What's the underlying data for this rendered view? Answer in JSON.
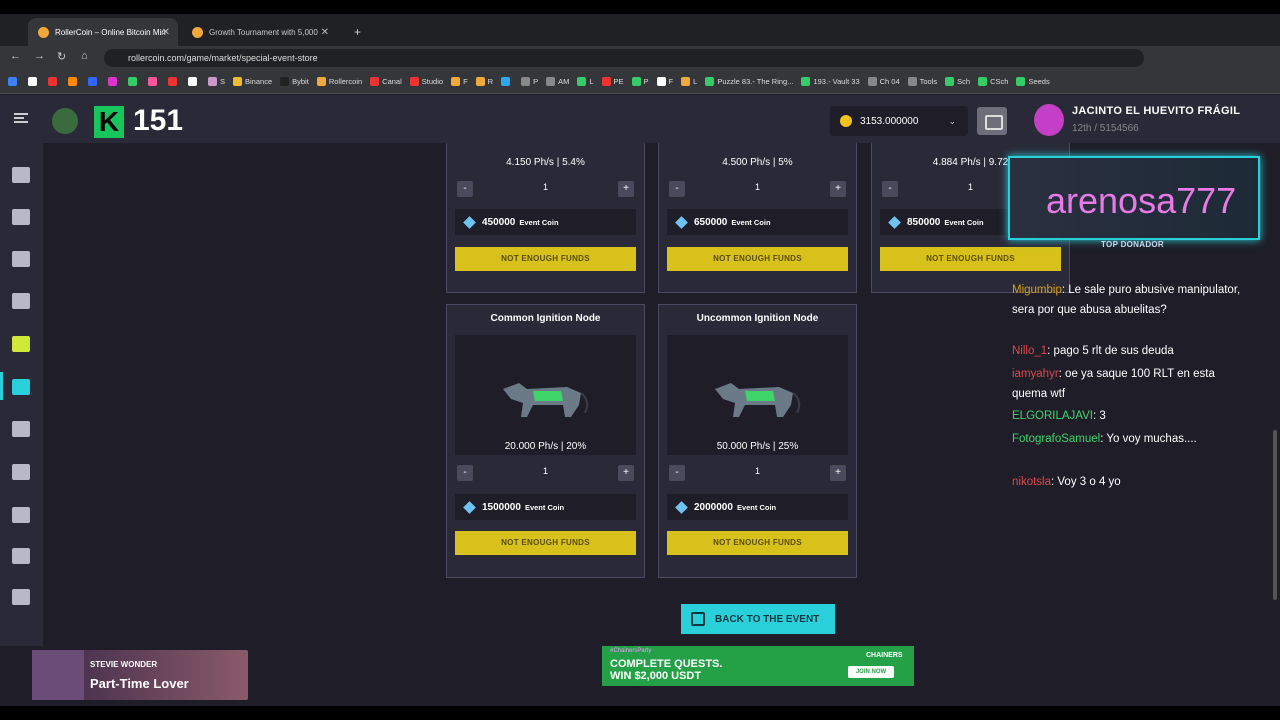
{
  "browser": {
    "tabs": [
      {
        "title": "RollerCoin – Online Bitcoin Min",
        "active": true
      },
      {
        "title": "Growth Tournament with 5,000",
        "active": false
      }
    ],
    "url": "rollercoin.com/game/market/special-event-store",
    "bookmarks": [
      "S",
      "Binance",
      "Bybit",
      "Rollercoin",
      "Canal",
      "Studio",
      "F",
      "R",
      "P",
      "AM",
      "L",
      "PE",
      "P",
      "F",
      "L",
      "Puzzle 83.- The Ring...",
      "193.- Vault 33",
      "Ch 04",
      "Tools",
      "Sch",
      "CSch",
      "Seeds"
    ]
  },
  "header": {
    "viewer_count": "151",
    "balance": "3153.000000",
    "username": "JACINTO EL HUEVITO FRÁGIL",
    "rank": "12th / 5154566"
  },
  "store": {
    "top_cards": [
      {
        "power": "4.150 Ph/s | 5.4%",
        "qty": "1",
        "price": "450000",
        "currency": "Event Coin",
        "button": "NOT ENOUGH FUNDS"
      },
      {
        "power": "4.500 Ph/s | 5%",
        "qty": "1",
        "price": "650000",
        "currency": "Event Coin",
        "button": "NOT ENOUGH FUNDS"
      },
      {
        "power": "4.884 Ph/s | 9.72",
        "qty": "1",
        "price": "850000",
        "currency": "Event Coin",
        "button": "NOT ENOUGH FUNDS"
      }
    ],
    "bottom_cards": [
      {
        "title": "Common Ignition Node",
        "power": "20.000 Ph/s | 20%",
        "qty": "1",
        "price": "1500000",
        "currency": "Event Coin",
        "button": "NOT ENOUGH FUNDS"
      },
      {
        "title": "Uncommon Ignition Node",
        "power": "50.000 Ph/s | 25%",
        "qty": "1",
        "price": "2000000",
        "currency": "Event Coin",
        "button": "NOT ENOUGH FUNDS"
      }
    ],
    "minus": "-",
    "plus": "+",
    "back_button": "BACK TO THE EVENT"
  },
  "ad": {
    "tag": "#ChainersParty",
    "line1": "COMPLETE QUESTS.",
    "line2": "WIN $2,000 USDT",
    "brand": "CHAINERS",
    "cta": "JOIN NOW"
  },
  "overlay": {
    "donor_name": "arenosa777",
    "donor_label": "TOP DONADOR",
    "music_artist": "STEVIE WONDER",
    "music_song": "Part-Time Lover",
    "chat": [
      {
        "user": "Migumbip",
        "msg": ": Le sale puro abusive manipulator, sera por que abusa abuelitas?",
        "color": "#d4a017"
      },
      {
        "user": "Nillo_1",
        "msg": ": pago 5 rlt de sus deuda",
        "color": "#e0454a"
      },
      {
        "user": "iamyahyr",
        "msg": ": oe ya saque 100 RLT en esta quema wtf",
        "color": "#e0454a"
      },
      {
        "user": "ELGORILAJAVI",
        "msg": ": 3",
        "color": "#3fd46a"
      },
      {
        "user": "FotografoSamuel",
        "msg": ": Yo voy muchas....",
        "color": "#3fd46a"
      },
      {
        "user": "nikotsla",
        "msg": ": Voy 3 o 4 yo",
        "color": "#e0454a"
      }
    ]
  },
  "colors": {
    "accent": "#2ad0d9",
    "button_disabled": "#d8c11a",
    "bg": "#1e1d28",
    "panel": "#2a2938"
  }
}
